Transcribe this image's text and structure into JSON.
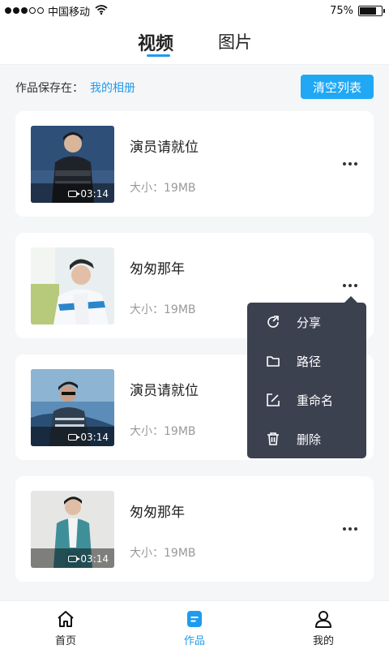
{
  "status_bar": {
    "carrier": "中国移动",
    "battery_percent": "75%",
    "battery_level": 0.75,
    "signal_icon": "signal-dots-icon",
    "wifi_icon": "wifi-icon"
  },
  "tabs": [
    {
      "label": "视频",
      "active": true
    },
    {
      "label": "图片",
      "active": false
    }
  ],
  "save_location": {
    "label": "作品保存在：",
    "link": "我的相册"
  },
  "clear_button": "清空列表",
  "items": [
    {
      "title": "演员请就位",
      "size": "大小：19MB",
      "duration": "03:14",
      "show_duration": true
    },
    {
      "title": "匆匆那年",
      "size": "大小：19MB",
      "duration": "",
      "show_duration": false
    },
    {
      "title": "演员请就位",
      "size": "大小：19MB",
      "duration": "03:14",
      "show_duration": true
    },
    {
      "title": "匆匆那年",
      "size": "大小：19MB",
      "duration": "03:14",
      "show_duration": true
    }
  ],
  "context_menu": [
    {
      "label": "分享",
      "icon": "share-icon"
    },
    {
      "label": "路径",
      "icon": "folder-icon"
    },
    {
      "label": "重命名",
      "icon": "edit-icon"
    },
    {
      "label": "删除",
      "icon": "trash-icon"
    }
  ],
  "bottom_nav": [
    {
      "label": "首页",
      "icon": "home-icon",
      "active": false
    },
    {
      "label": "作品",
      "icon": "works-icon",
      "active": true
    },
    {
      "label": "我的",
      "icon": "user-icon",
      "active": false
    }
  ],
  "colors": {
    "accent": "#1e9bef",
    "button": "#20a8f5",
    "menu_bg": "#3c4150",
    "page_bg": "#f5f6f8"
  }
}
